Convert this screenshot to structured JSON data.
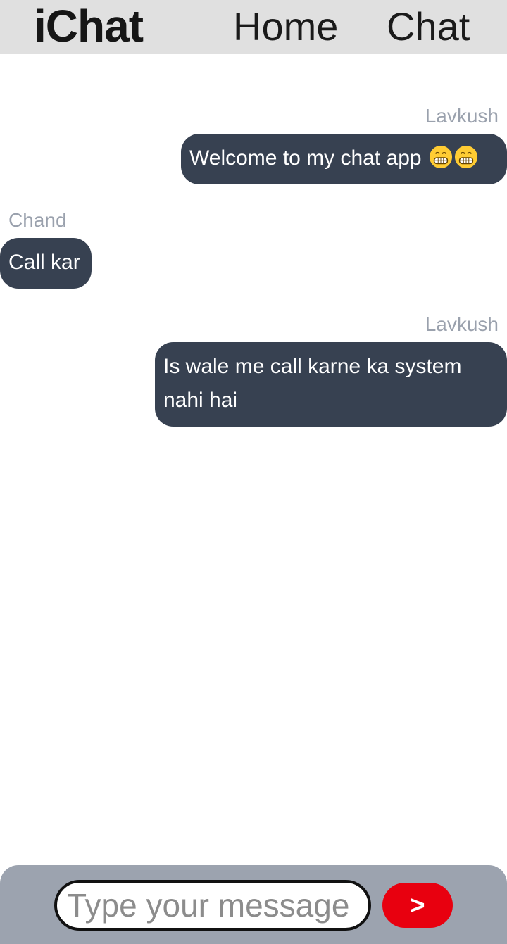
{
  "navbar": {
    "brand": "iChat",
    "links": [
      {
        "label": "Home"
      },
      {
        "label": "Chat"
      }
    ]
  },
  "messages": [
    {
      "sender": "Lavkush",
      "text": "Welcome to my chat app",
      "emojis": [
        "grinning-face-icon",
        "grinning-face-icon"
      ],
      "side": "right"
    },
    {
      "sender": "Chand",
      "text": "Call kar",
      "side": "left"
    },
    {
      "sender": "Lavkush",
      "text": "Is wale me call karne ka system nahi hai",
      "side": "right"
    }
  ],
  "composer": {
    "placeholder": "Type your message",
    "value": "",
    "send_label": ">"
  },
  "colors": {
    "navbar_bg": "#e0e0e0",
    "bubble_bg": "#374151",
    "sender_text": "#9aa1ad",
    "composer_bg": "#9ca3af",
    "send_button": "#e8000f"
  }
}
